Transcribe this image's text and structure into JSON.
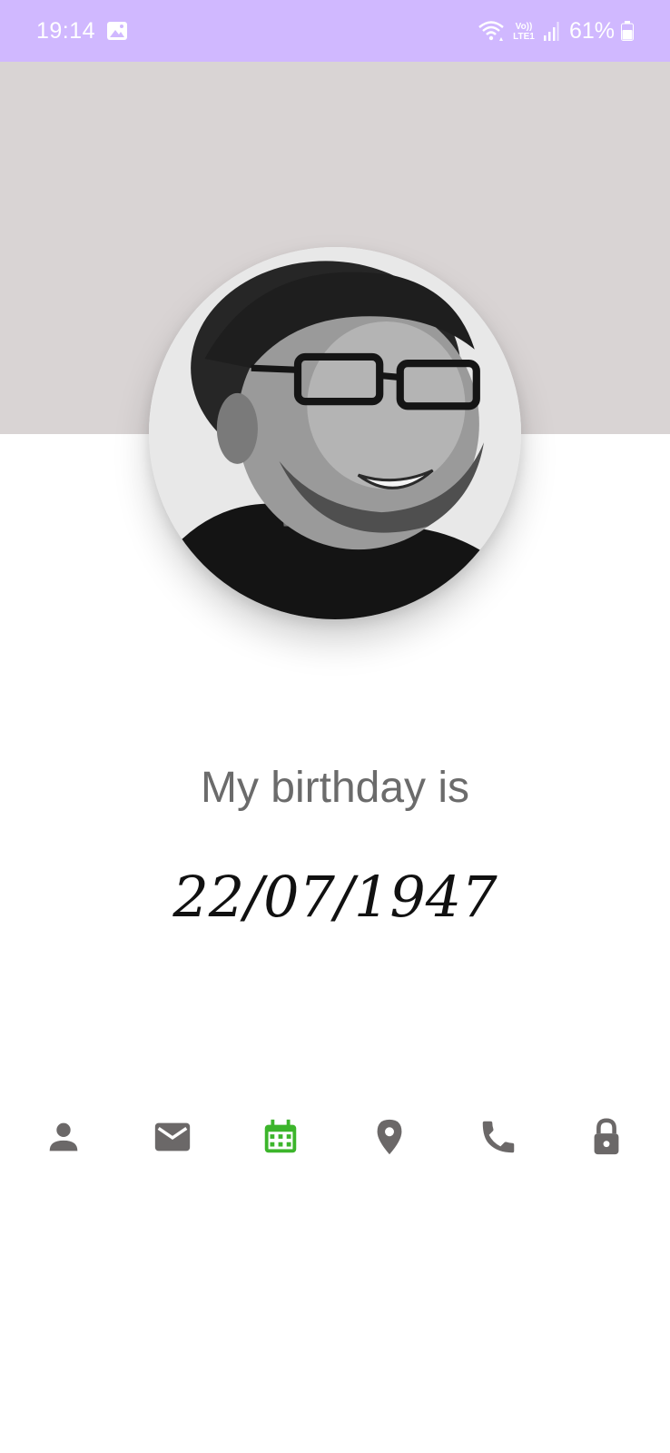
{
  "status_bar": {
    "time": "19:14",
    "battery": "61%",
    "icons": [
      "gallery-icon",
      "wifi-icon",
      "volte-lte-icon",
      "signal-icon",
      "battery-icon"
    ]
  },
  "profile": {
    "header_color": "#d9d4d4",
    "avatar": "profile-photo"
  },
  "info": {
    "title": "My birthday is",
    "value": "22/07/1947"
  },
  "nav": {
    "active": "calendar",
    "active_color": "#3cb52b",
    "inactive_color": "#6b6868",
    "items": [
      {
        "id": "user",
        "icon": "person-icon"
      },
      {
        "id": "email",
        "icon": "mail-icon"
      },
      {
        "id": "calendar",
        "icon": "calendar-icon"
      },
      {
        "id": "location",
        "icon": "location-pin-icon"
      },
      {
        "id": "phone",
        "icon": "phone-icon"
      },
      {
        "id": "password",
        "icon": "lock-icon"
      }
    ]
  }
}
